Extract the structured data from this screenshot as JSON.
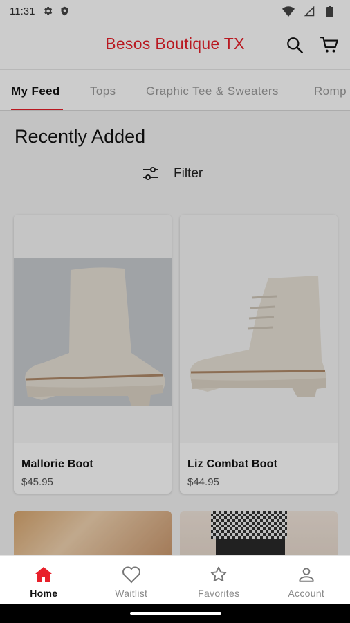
{
  "status_bar": {
    "time": "11:31",
    "icons": [
      "gear-icon",
      "shield-icon",
      "wifi-icon",
      "signal-icon",
      "battery-icon"
    ]
  },
  "app_bar": {
    "title": "Besos Boutique TX",
    "icons": [
      "search-icon",
      "cart-icon"
    ]
  },
  "tabs": [
    {
      "label": "My Feed",
      "active": true
    },
    {
      "label": "Tops",
      "active": false
    },
    {
      "label": "Graphic Tee & Sweaters",
      "active": false
    },
    {
      "label": "Romp",
      "active": false
    }
  ],
  "feed": {
    "section_title": "Recently Added",
    "filter_label": "Filter",
    "filter_icon": "sliders-icon"
  },
  "products": [
    {
      "name": "Mallorie Boot",
      "price": "$45.95"
    },
    {
      "name": "Liz Combat Boot",
      "price": "$44.95"
    }
  ],
  "bottom_nav": [
    {
      "label": "Home",
      "icon": "home-icon",
      "active": true
    },
    {
      "label": "Waitlist",
      "icon": "heart-icon",
      "active": false
    },
    {
      "label": "Favorites",
      "icon": "star-icon",
      "active": false
    },
    {
      "label": "Account",
      "icon": "person-icon",
      "active": false
    }
  ],
  "colors": {
    "brand_red": "#e8202a",
    "text_dark": "#111111",
    "text_muted": "#8a8a8a"
  }
}
